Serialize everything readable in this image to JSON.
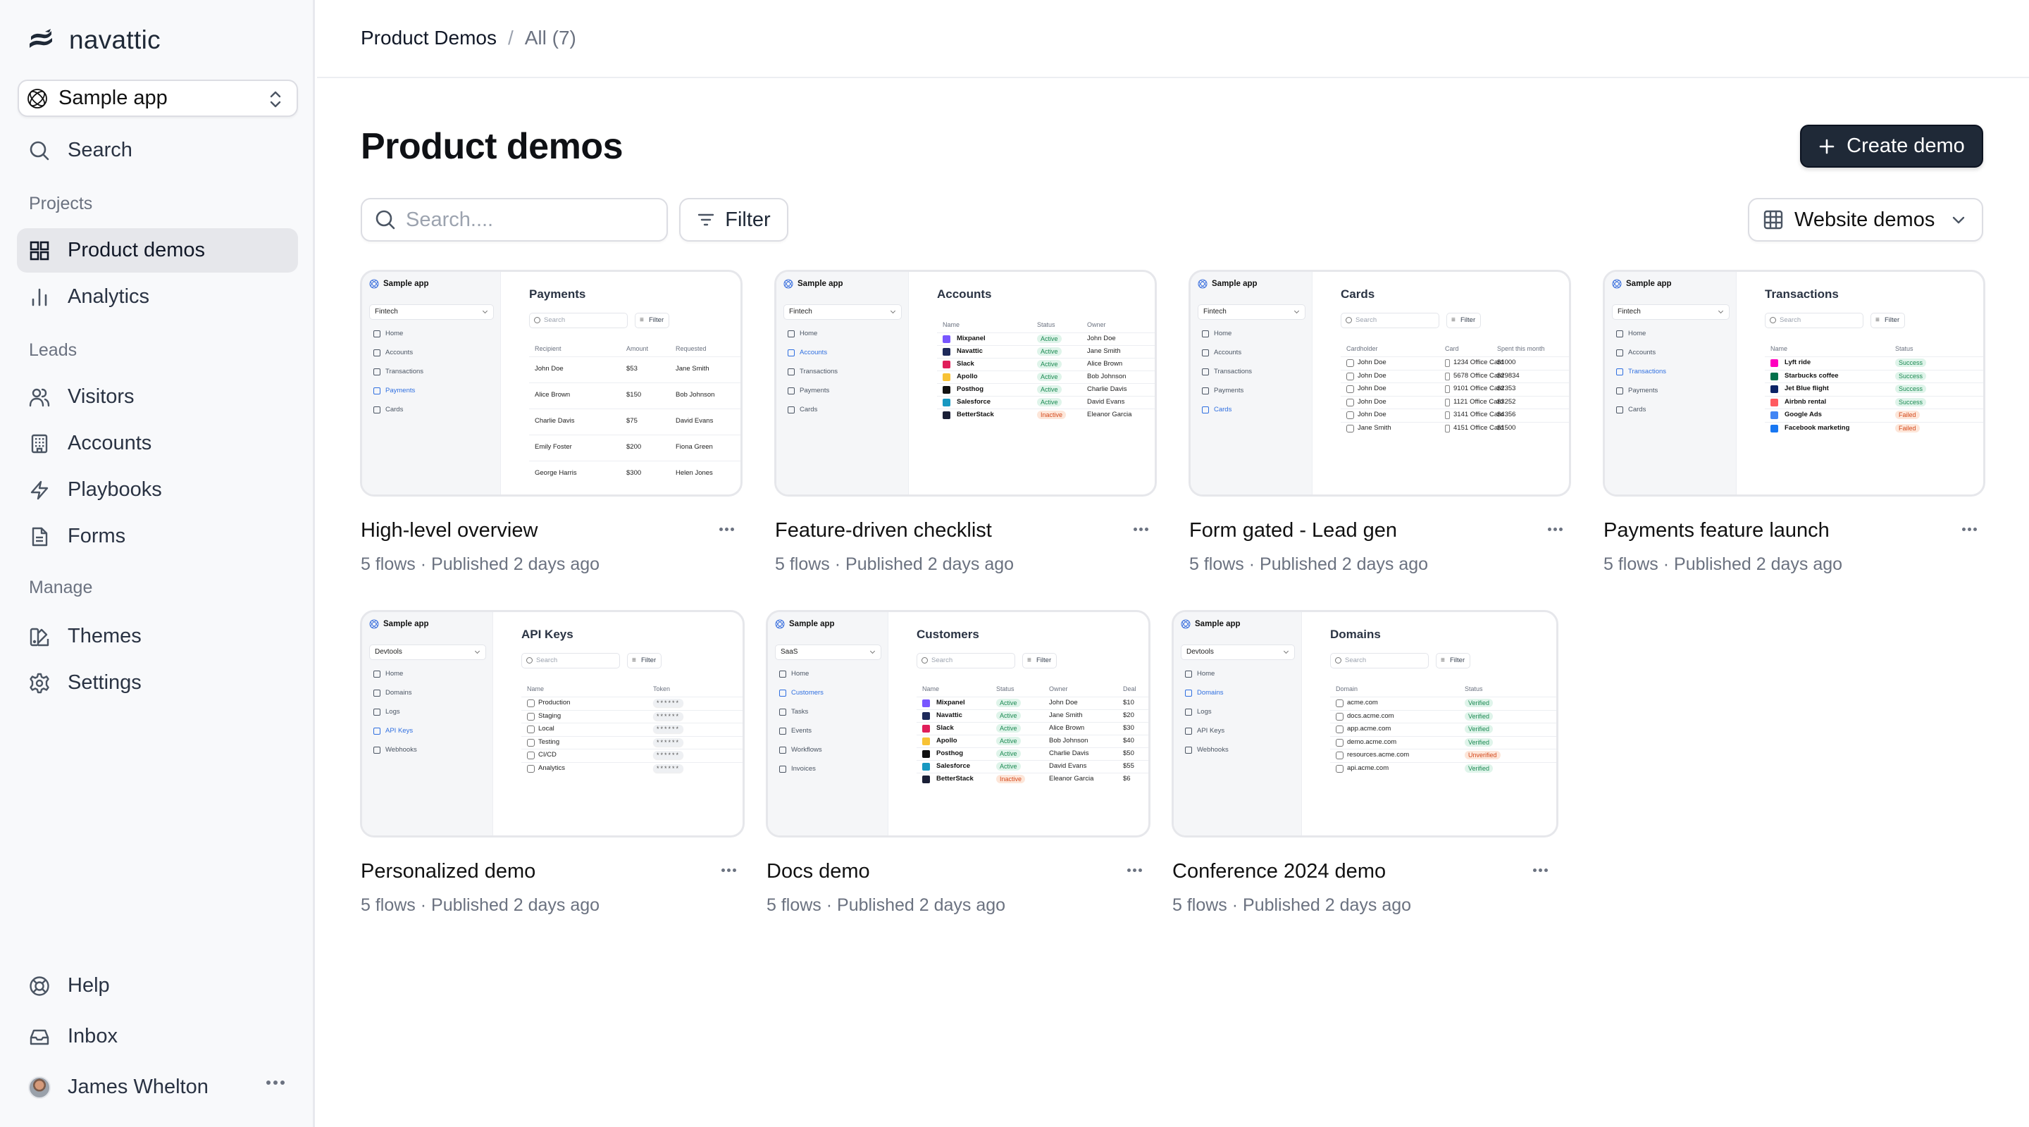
{
  "sidebar": {
    "brand": "navattic",
    "app_switcher": "Sample app",
    "search_label": "Search",
    "sections": {
      "projects": "Projects",
      "leads": "Leads",
      "manage": "Manage"
    },
    "items": {
      "product_demos": "Product demos",
      "analytics": "Analytics",
      "visitors": "Visitors",
      "accounts": "Accounts",
      "playbooks": "Playbooks",
      "forms": "Forms",
      "themes": "Themes",
      "settings": "Settings",
      "help": "Help",
      "inbox": "Inbox"
    },
    "user": {
      "name": "James Whelton"
    },
    "active_item": "Product demos"
  },
  "header": {
    "breadcrumb_root": "Product Demos",
    "breadcrumb_separator": "/",
    "breadcrumb_current": "All (7)"
  },
  "main": {
    "title": "Product demos",
    "create_button": "Create demo",
    "search_placeholder": "Search....",
    "search_value": "",
    "filter_button": "Filter",
    "view_select": "Website demos"
  },
  "colors": {
    "accent_dark": "#1f2937",
    "link_blue": "#2f6fe0",
    "success_green": "#1c8a52",
    "failed_orange": "#d4491c"
  },
  "demos": [
    {
      "title": "High-level overview",
      "meta": "5 flows · Published 2 days ago",
      "preview": {
        "app": "Sample app",
        "workspace": "Fintech",
        "nav": [
          "Home",
          "Accounts",
          "Transactions",
          "Payments",
          "Cards"
        ],
        "active_nav": "Payments",
        "heading": "Payments",
        "search": "Search",
        "filter": "Filter",
        "columns": [
          "Recipient",
          "Amount",
          "Requested"
        ],
        "rows": [
          [
            "John Doe",
            "$53",
            "Jane Smith"
          ],
          [
            "Alice Brown",
            "$150",
            "Bob Johnson"
          ],
          [
            "Charlie Davis",
            "$75",
            "David Evans"
          ],
          [
            "Emily Foster",
            "$200",
            "Fiona Green"
          ],
          [
            "George Harris",
            "$300",
            "Helen Jones"
          ]
        ]
      }
    },
    {
      "title": "Feature-driven checklist",
      "meta": "5 flows · Published 2 days ago",
      "preview": {
        "app": "Sample app",
        "workspace": "Fintech",
        "nav": [
          "Home",
          "Accounts",
          "Transactions",
          "Payments",
          "Cards"
        ],
        "active_nav": "Accounts",
        "heading": "Accounts",
        "columns": [
          "Name",
          "Status",
          "Owner"
        ],
        "rows": [
          [
            "Mixpanel",
            "Active",
            "John Doe"
          ],
          [
            "Navattic",
            "Active",
            "Jane Smith"
          ],
          [
            "Slack",
            "Active",
            "Alice Brown"
          ],
          [
            "Apollo",
            "Active",
            "Bob Johnson"
          ],
          [
            "Posthog",
            "Active",
            "Charlie Davis"
          ],
          [
            "Salesforce",
            "Active",
            "David Evans"
          ],
          [
            "BetterStack",
            "Inactive",
            "Eleanor Garcia"
          ]
        ]
      }
    },
    {
      "title": "Form gated - Lead gen",
      "meta": "5 flows · Published 2 days ago",
      "preview": {
        "app": "Sample app",
        "workspace": "Fintech",
        "nav": [
          "Home",
          "Accounts",
          "Transactions",
          "Payments",
          "Cards"
        ],
        "active_nav": "Cards",
        "heading": "Cards",
        "search": "Search",
        "filter": "Filter",
        "columns": [
          "Cardholder",
          "Card",
          "Spent this month"
        ],
        "rows": [
          [
            "John Doe",
            "1234 Office Card",
            "$1000"
          ],
          [
            "John Doe",
            "5678 Office Card",
            "$29834"
          ],
          [
            "John Doe",
            "9101 Office Card",
            "$2353"
          ],
          [
            "John Doe",
            "1121 Office Card",
            "$3252"
          ],
          [
            "John Doe",
            "3141 Office Card",
            "$4356"
          ],
          [
            "Jane Smith",
            "4151 Office Card",
            "$1500"
          ]
        ]
      }
    },
    {
      "title": "Payments feature launch",
      "meta": "5 flows · Published 2 days ago",
      "preview": {
        "app": "Sample app",
        "workspace": "Fintech",
        "nav": [
          "Home",
          "Accounts",
          "Transactions",
          "Payments",
          "Cards"
        ],
        "active_nav": "Transactions",
        "heading": "Transactions",
        "search": "Search",
        "filter": "Filter",
        "columns": [
          "Name",
          "Status"
        ],
        "rows": [
          [
            "Lyft ride",
            "Success"
          ],
          [
            "Starbucks coffee",
            "Success"
          ],
          [
            "Jet Blue flight",
            "Success"
          ],
          [
            "Airbnb rental",
            "Success"
          ],
          [
            "Google Ads",
            "Failed"
          ],
          [
            "Facebook marketing",
            "Failed"
          ]
        ]
      }
    },
    {
      "title": "Personalized demo",
      "meta": "5 flows · Published 2 days ago",
      "preview": {
        "app": "Sample app",
        "workspace": "Devtools",
        "nav": [
          "Home",
          "Domains",
          "Logs",
          "API Keys",
          "Webhooks"
        ],
        "active_nav": "API Keys",
        "heading": "API Keys",
        "search": "Search",
        "filter": "Filter",
        "columns": [
          "Name",
          "Token"
        ],
        "rows": [
          [
            "Production",
            "******"
          ],
          [
            "Staging",
            "******"
          ],
          [
            "Local",
            "******"
          ],
          [
            "Testing",
            "******"
          ],
          [
            "CI/CD",
            "******"
          ],
          [
            "Analytics",
            "******"
          ]
        ]
      }
    },
    {
      "title": "Docs demo",
      "meta": "5 flows · Published 2 days ago",
      "preview": {
        "app": "Sample app",
        "workspace": "SaaS",
        "nav": [
          "Home",
          "Customers",
          "Tasks",
          "Events",
          "Workflows",
          "Invoices"
        ],
        "active_nav": "Customers",
        "heading": "Customers",
        "search": "Search",
        "filter": "Filter",
        "columns": [
          "Name",
          "Status",
          "Owner",
          "Deal"
        ],
        "rows": [
          [
            "Mixpanel",
            "Active",
            "John Doe",
            "$10"
          ],
          [
            "Navattic",
            "Active",
            "Jane Smith",
            "$20"
          ],
          [
            "Slack",
            "Active",
            "Alice Brown",
            "$30"
          ],
          [
            "Apollo",
            "Active",
            "Bob Johnson",
            "$40"
          ],
          [
            "Posthog",
            "Active",
            "Charlie Davis",
            "$50"
          ],
          [
            "Salesforce",
            "Active",
            "David Evans",
            "$55"
          ],
          [
            "BetterStack",
            "Inactive",
            "Eleanor Garcia",
            "$6"
          ]
        ]
      }
    },
    {
      "title": "Conference 2024 demo",
      "meta": "5 flows · Published 2 days ago",
      "preview": {
        "app": "Sample app",
        "workspace": "Devtools",
        "nav": [
          "Home",
          "Domains",
          "Logs",
          "API Keys",
          "Webhooks"
        ],
        "active_nav": "Domains",
        "heading": "Domains",
        "search": "Search",
        "filter": "Filter",
        "columns": [
          "Domain",
          "Status"
        ],
        "rows": [
          [
            "acme.com",
            "Verified"
          ],
          [
            "docs.acme.com",
            "Verified"
          ],
          [
            "app.acme.com",
            "Verified"
          ],
          [
            "demo.acme.com",
            "Verified"
          ],
          [
            "resources.acme.com",
            "Unverified"
          ],
          [
            "api.acme.com",
            "Verified"
          ]
        ]
      }
    }
  ]
}
